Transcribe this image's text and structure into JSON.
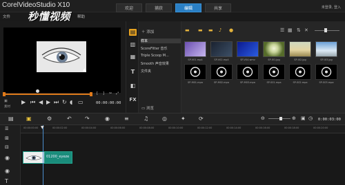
{
  "app": {
    "title_brand": "Corel",
    "title_product": "VideoStudio X10"
  },
  "tabs": [
    {
      "label": "欢迎",
      "active": false
    },
    {
      "label": "捕获",
      "active": false
    },
    {
      "label": "编辑",
      "active": true
    },
    {
      "label": "共享",
      "active": false
    }
  ],
  "account": "未登录, 登入",
  "menu": [
    "文件",
    "编辑",
    "工具",
    "设置",
    "帮助"
  ],
  "watermark": "秒懂视频",
  "player": {
    "mode_label": "素材",
    "timecode": "00:00:00:00",
    "controls": [
      "play-icon",
      "home-icon",
      "prev-frame-icon",
      "next-frame-icon",
      "end-icon",
      "repeat-icon",
      "volume-icon"
    ]
  },
  "library": {
    "add_label": "添加",
    "folders": [
      {
        "label": "样本",
        "selected": true
      },
      {
        "label": "ScoreFitter 音乐",
        "selected": false
      },
      {
        "label": "Triple Scoop M...",
        "selected": false
      },
      {
        "label": "Smooth 声音效果",
        "selected": false
      },
      {
        "label": "文件夹",
        "selected": false
      }
    ],
    "browse_label": "浏览",
    "items": [
      {
        "caption": "SP-V01.mp4",
        "kind": "purple"
      },
      {
        "caption": "SP-V02.mp4",
        "kind": "dark"
      },
      {
        "caption": "SP-V04.wmv",
        "kind": "blue"
      },
      {
        "caption": "SP-I01.jpg",
        "kind": "green"
      },
      {
        "caption": "SP-I02.jpg",
        "kind": "field"
      },
      {
        "caption": "SP-I03.jpg",
        "kind": "sky"
      },
      {
        "caption": "SP-M01.mpa",
        "kind": "audio"
      },
      {
        "caption": "SP-M02.mpa",
        "kind": "audio"
      },
      {
        "caption": "SP-M03.mpa",
        "kind": "audio"
      },
      {
        "caption": "SP-S01.mpa",
        "kind": "audio"
      },
      {
        "caption": "SP-S02.mpa",
        "kind": "audio"
      },
      {
        "caption": "SP-S03.mpa",
        "kind": "audio"
      }
    ]
  },
  "timeline": {
    "timecode": "0:00:03:00",
    "ruler": [
      "00:00:00:00",
      "00:00:02:00",
      "00:00:04:00",
      "00:00:06:00",
      "00:00:08:00",
      "00:00:10:00",
      "00:00:12:00",
      "00:00:14:00",
      "00:00:16:00",
      "00:00:18:00",
      "00:00:20:00"
    ],
    "clip_label": "01200_eyeze"
  },
  "colors": {
    "accent_blue": "#2a7fc4",
    "accent_orange": "#e07a1a",
    "library_active": "#e8a320",
    "clip_teal": "#1a8c7b"
  }
}
